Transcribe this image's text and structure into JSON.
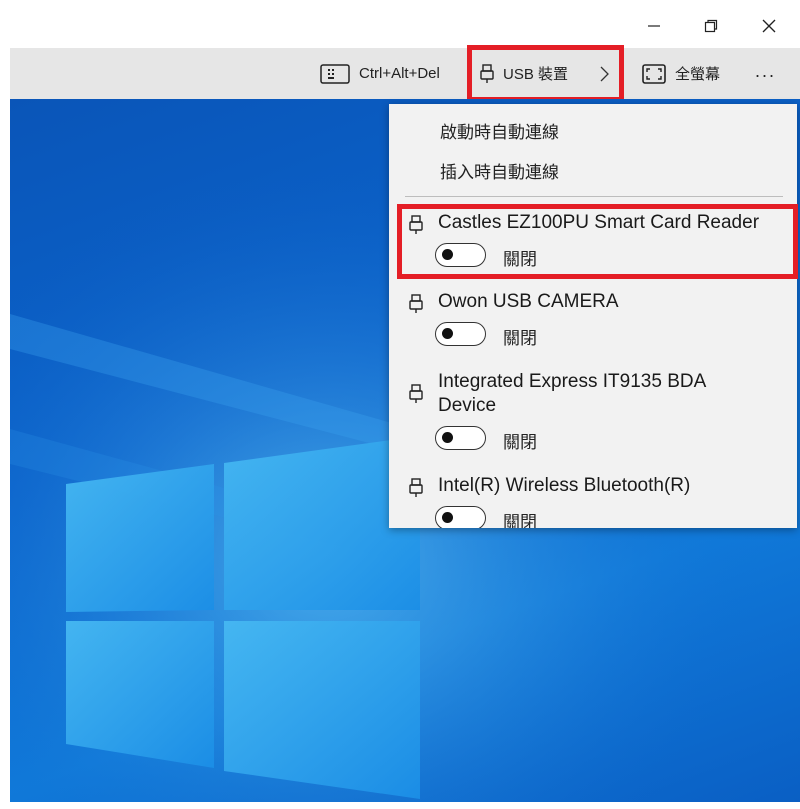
{
  "window": {
    "minimize_icon": "minimize-icon",
    "restore_icon": "restore-icon",
    "close_icon": "close-icon"
  },
  "toolbar": {
    "ctrl_alt_del_label": "Ctrl+Alt+Del",
    "usb_label": "USB 裝置",
    "fullscreen_label": "全螢幕",
    "more_label": "..."
  },
  "usb_menu": {
    "auto_connect_on_start": "啟動時自動連線",
    "auto_connect_on_insert": "插入時自動連線",
    "devices": [
      {
        "name": "Castles EZ100PU Smart Card Reader",
        "state": "關閉",
        "on": false
      },
      {
        "name": "Owon USB CAMERA",
        "state": "關閉",
        "on": false
      },
      {
        "name": "Integrated Express IT9135 BDA Device",
        "state": "關閉",
        "on": false
      },
      {
        "name": "Intel(R) Wireless Bluetooth(R)",
        "state": "關閉",
        "on": false
      }
    ]
  },
  "colors": {
    "highlight": "#e41e26",
    "toolbar_bg": "#e6e6e6",
    "menu_bg": "#f2f2f2",
    "desktop_blue": "#0b64cc"
  }
}
